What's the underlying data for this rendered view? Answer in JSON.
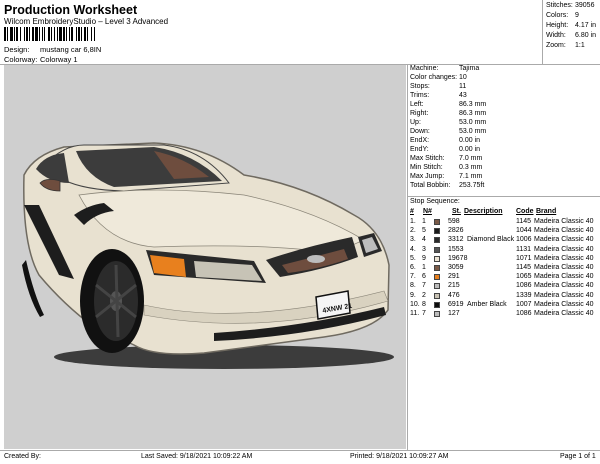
{
  "header": {
    "title": "Production Worksheet",
    "subtitle": "Wilcom EmbroideryStudio – Level 3 Advanced",
    "design_label": "Design:",
    "design_value": "mustang car 6,8IN",
    "colorway_label": "Colorway:",
    "colorway_value": "Colorway 1"
  },
  "stats": [
    {
      "label": "Stitches:",
      "value": "39056"
    },
    {
      "label": "Colors:",
      "value": "9"
    },
    {
      "label": "Height:",
      "value": "4.17 in"
    },
    {
      "label": "Width:",
      "value": "6.80 in"
    },
    {
      "label": "Zoom:",
      "value": "1:1"
    }
  ],
  "machine_info": [
    {
      "label": "Machine:",
      "value": "Tajima"
    },
    {
      "label": "Color changes:",
      "value": "10"
    },
    {
      "label": "Stops:",
      "value": "11"
    },
    {
      "label": "Trims:",
      "value": "43"
    },
    {
      "label": "Left:",
      "value": "86.3 mm"
    },
    {
      "label": "Right:",
      "value": "86.3 mm"
    },
    {
      "label": "Up:",
      "value": "53.0 mm"
    },
    {
      "label": "Down:",
      "value": "53.0 mm"
    },
    {
      "label": "EndX:",
      "value": "0.00 in"
    },
    {
      "label": "EndY:",
      "value": "0.00 in"
    },
    {
      "label": "Max Stitch:",
      "value": "7.0 mm"
    },
    {
      "label": "Min Stitch:",
      "value": "0.3 mm"
    },
    {
      "label": "Max Jump:",
      "value": "7.1 mm"
    },
    {
      "label": "Total Bobbin:",
      "value": "253.75ft"
    }
  ],
  "stop_sequence": {
    "title": "Stop Sequence:",
    "columns": [
      "#",
      "N#",
      "St.",
      "Description",
      "Code",
      "Brand"
    ],
    "rows": [
      {
        "idx": "1.",
        "n": "1",
        "color": "#7a5a48",
        "st": "598",
        "desc": "",
        "code": "1145",
        "brand": "Madeira Classic 40"
      },
      {
        "idx": "2.",
        "n": "5",
        "color": "#1a1a1a",
        "st": "2826",
        "desc": "",
        "code": "1044",
        "brand": "Madeira Classic 40"
      },
      {
        "idx": "3.",
        "n": "4",
        "color": "#2a2a2a",
        "st": "3312",
        "desc": "Diamond Black",
        "code": "1006",
        "brand": "Madeira Classic 40"
      },
      {
        "idx": "4.",
        "n": "3",
        "color": "#555555",
        "st": "1553",
        "desc": "",
        "code": "1131",
        "brand": "Madeira Classic 40"
      },
      {
        "idx": "5.",
        "n": "9",
        "color": "#ece4d4",
        "st": "19678",
        "desc": "",
        "code": "1071",
        "brand": "Madeira Classic 40"
      },
      {
        "idx": "6.",
        "n": "1",
        "color": "#7a5a48",
        "st": "3059",
        "desc": "",
        "code": "1145",
        "brand": "Madeira Classic 40"
      },
      {
        "idx": "7.",
        "n": "6",
        "color": "#e8801e",
        "st": "291",
        "desc": "",
        "code": "1065",
        "brand": "Madeira Classic 40"
      },
      {
        "idx": "8.",
        "n": "7",
        "color": "#bdbdbd",
        "st": "215",
        "desc": "",
        "code": "1086",
        "brand": "Madeira Classic 40"
      },
      {
        "idx": "9.",
        "n": "2",
        "color": "#c9c3b5",
        "st": "476",
        "desc": "",
        "code": "1339",
        "brand": "Madeira Classic 40"
      },
      {
        "idx": "10.",
        "n": "8",
        "color": "#0d0d0d",
        "st": "6919",
        "desc": "Amber Black",
        "code": "1007",
        "brand": "Madeira Classic 40"
      },
      {
        "idx": "11.",
        "n": "7",
        "color": "#bdbdbd",
        "st": "127",
        "desc": "",
        "code": "1086",
        "brand": "Madeira Classic 40"
      }
    ]
  },
  "license_plate": "4XNW 21",
  "footer": {
    "created_by": "Created By:",
    "last_saved": "Last Saved: 9/18/2021 10:09:22 AM",
    "printed": "Printed: 9/18/2021 10:09:27 AM",
    "page": "Page 1 of 1"
  }
}
